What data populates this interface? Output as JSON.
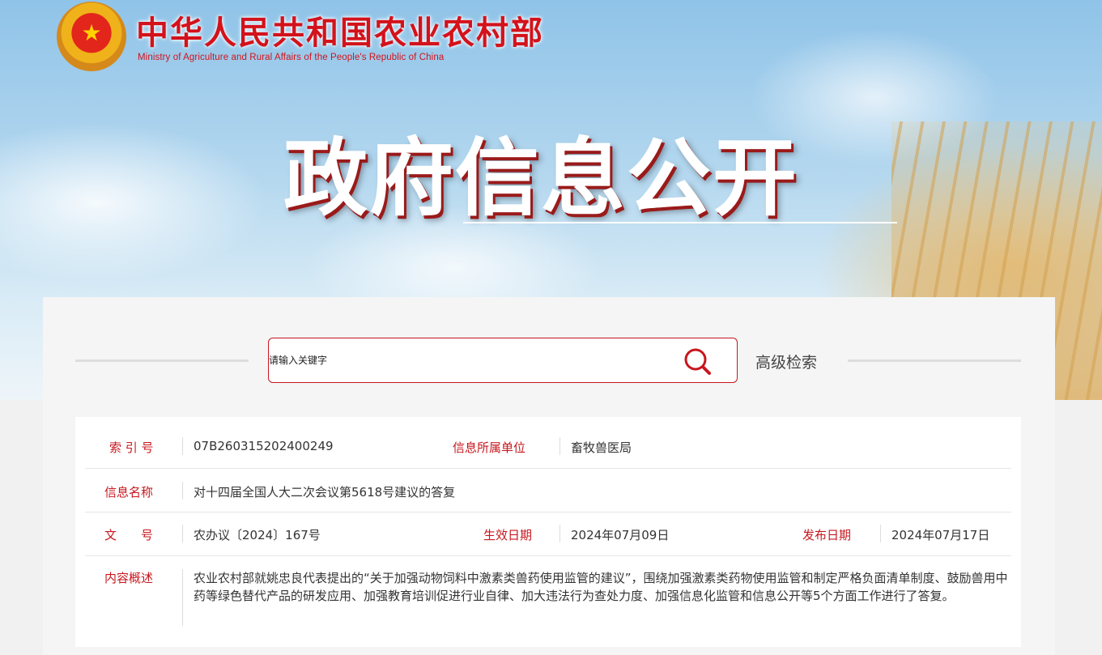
{
  "header": {
    "ministry_cn": "中华人民共和国农业农村部",
    "ministry_en": "Ministry of Agriculture and Rural Affairs of the People's Republic of China",
    "hero_title": "政府信息公开",
    "emblem_icon": "national-emblem-icon"
  },
  "search": {
    "placeholder": "请输入关键字",
    "advanced_label": "高级检索",
    "icon": "search-icon",
    "accent_color": "#c7171e"
  },
  "info": {
    "index_label": "索 引 号",
    "index_value": "07B260315202400249",
    "unit_label": "信息所属单位",
    "unit_value": "畜牧兽医局",
    "name_label": "信息名称",
    "name_value": "对十四届全国人大二次会议第5618号建议的答复",
    "doc_label": "文　　号",
    "doc_value": "农办议〔2024〕167号",
    "effective_label": "生效日期",
    "effective_value": "2024年07月09日",
    "publish_label": "发布日期",
    "publish_value": "2024年07月17日",
    "summary_label": "内容概述",
    "summary_value": "农业农村部就姚忠良代表提出的“关于加强动物饲料中激素类兽药使用监管的建议”，围绕加强激素类药物使用监管和制定严格负面清单制度、鼓励兽用中药等绿色替代产品的研发应用、加强教育培训促进行业自律、加大违法行为查处力度、加强信息化监管和信息公开等5个方面工作进行了答复。"
  }
}
